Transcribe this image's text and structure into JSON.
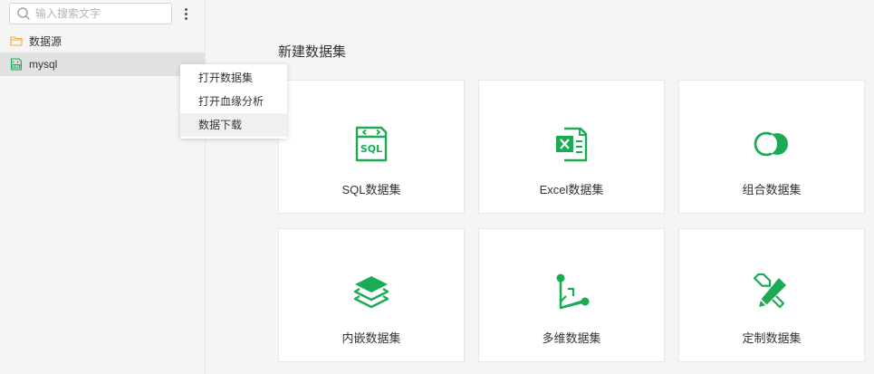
{
  "sidebar": {
    "search": {
      "placeholder": "输入搜索文字",
      "value": ""
    },
    "more_icon": "more-vertical-icon",
    "items": [
      {
        "label": "数据源",
        "icon": "folder-icon",
        "icon_color": "#f2a93b"
      },
      {
        "label": "mysql",
        "icon": "sql-file-icon",
        "icon_color": "#1aab54",
        "selected": true
      }
    ]
  },
  "context_menu": {
    "items": [
      {
        "label": "打开数据集"
      },
      {
        "label": "打开血缘分析"
      },
      {
        "label": "数据下载",
        "hovered": true
      }
    ]
  },
  "main": {
    "title": "新建数据集",
    "accent_color": "#1aab54",
    "cards": [
      {
        "label": "SQL数据集",
        "icon": "sql-dataset-icon"
      },
      {
        "label": "Excel数据集",
        "icon": "excel-dataset-icon"
      },
      {
        "label": "组合数据集",
        "icon": "combined-dataset-icon"
      },
      {
        "label": "内嵌数据集",
        "icon": "embedded-dataset-icon"
      },
      {
        "label": "多维数据集",
        "icon": "multidimensional-dataset-icon"
      },
      {
        "label": "定制数据集",
        "icon": "custom-dataset-icon"
      }
    ]
  }
}
